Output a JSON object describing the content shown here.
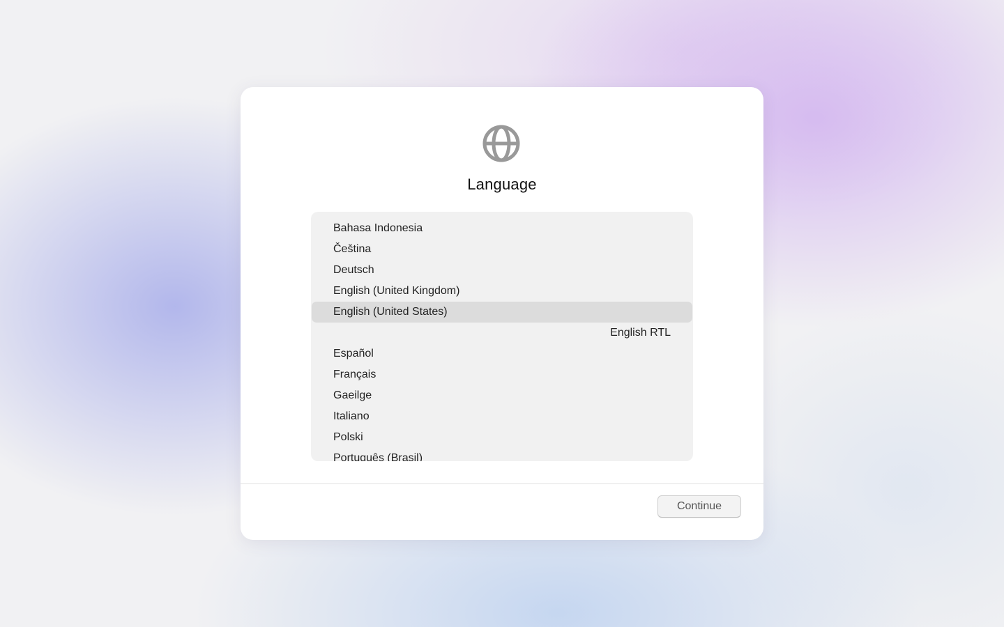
{
  "icons": {
    "header_icon": "globe-icon"
  },
  "colors": {
    "selection_background": "#dcdcdc",
    "list_background": "#f1f1f1",
    "icon_color": "#999999"
  },
  "dialog": {
    "title": "Language",
    "languages": [
      {
        "label": "Bahasa Indonesia"
      },
      {
        "label": "Čeština"
      },
      {
        "label": "Deutsch"
      },
      {
        "label": "English (United Kingdom)"
      },
      {
        "label": "English (United States)",
        "selected": true
      },
      {
        "label": "English RTL",
        "direction": "rtl"
      },
      {
        "label": "Español"
      },
      {
        "label": "Français"
      },
      {
        "label": "Gaeilge"
      },
      {
        "label": "Italiano"
      },
      {
        "label": "Polski"
      },
      {
        "label": "Português (Brasil)"
      }
    ],
    "continue_label": "Continue"
  }
}
